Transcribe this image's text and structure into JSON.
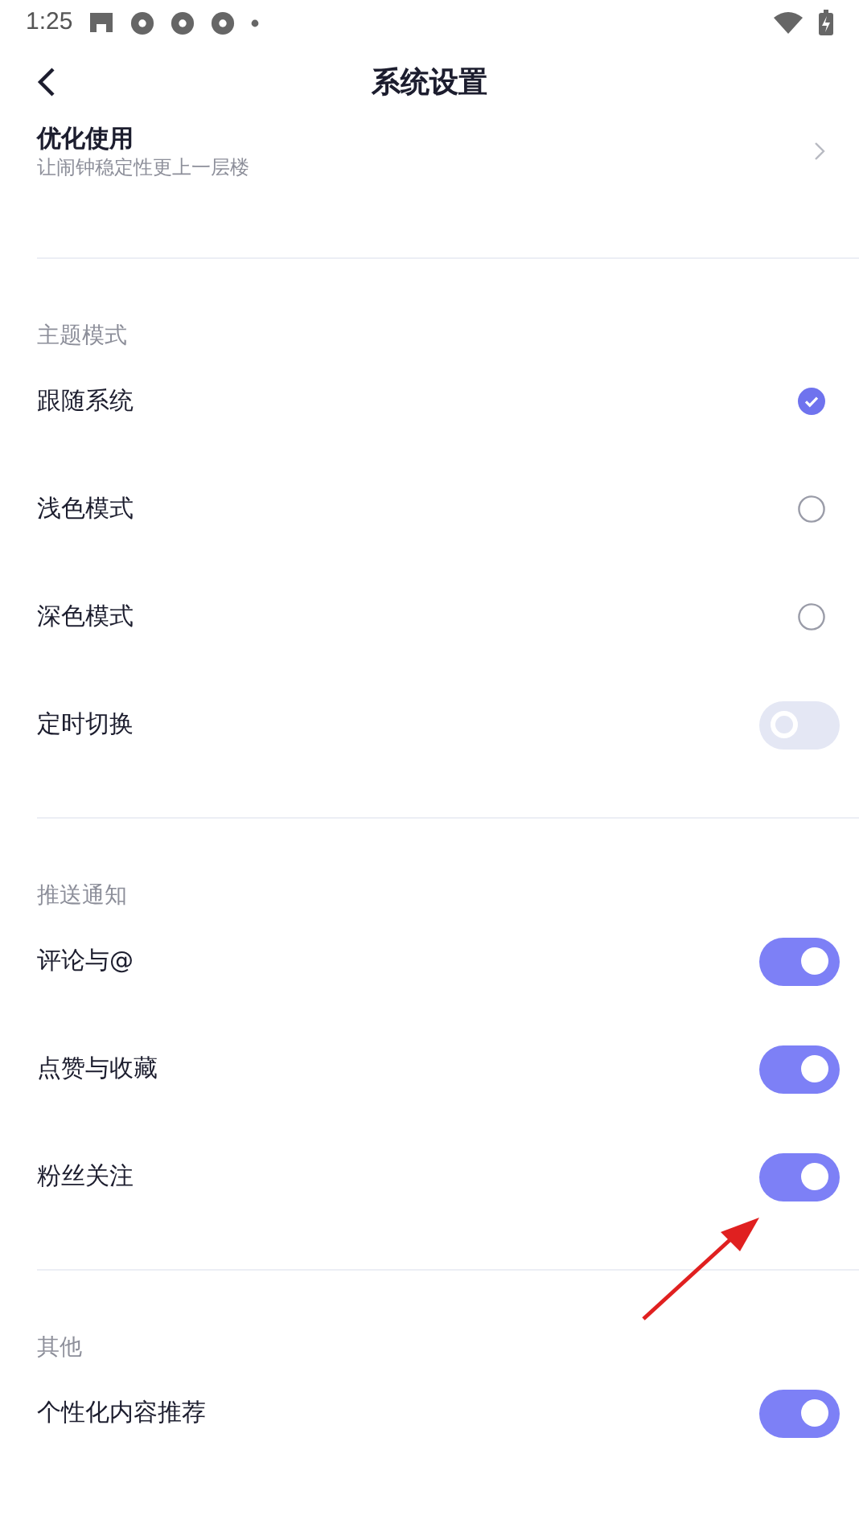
{
  "status_bar": {
    "time": "1:25"
  },
  "header": {
    "title": "系统设置"
  },
  "top_item": {
    "title": "优化使用",
    "subtitle": "让闹钟稳定性更上一层楼"
  },
  "sections": [
    {
      "title": "主题模式",
      "items": [
        {
          "kind": "radio",
          "label": "跟随系统",
          "selected": true
        },
        {
          "kind": "radio",
          "label": "浅色模式",
          "selected": false
        },
        {
          "kind": "radio",
          "label": "深色模式",
          "selected": false
        },
        {
          "kind": "toggle",
          "label": "定时切换",
          "on": false
        }
      ]
    },
    {
      "title": "推送通知",
      "items": [
        {
          "kind": "toggle",
          "label": "评论与@",
          "on": true
        },
        {
          "kind": "toggle",
          "label": "点赞与收藏",
          "on": true
        },
        {
          "kind": "toggle",
          "label": "粉丝关注",
          "on": true
        }
      ]
    },
    {
      "title": "其他",
      "items": [
        {
          "kind": "toggle",
          "label": "个性化内容推荐",
          "on": true
        }
      ]
    }
  ]
}
